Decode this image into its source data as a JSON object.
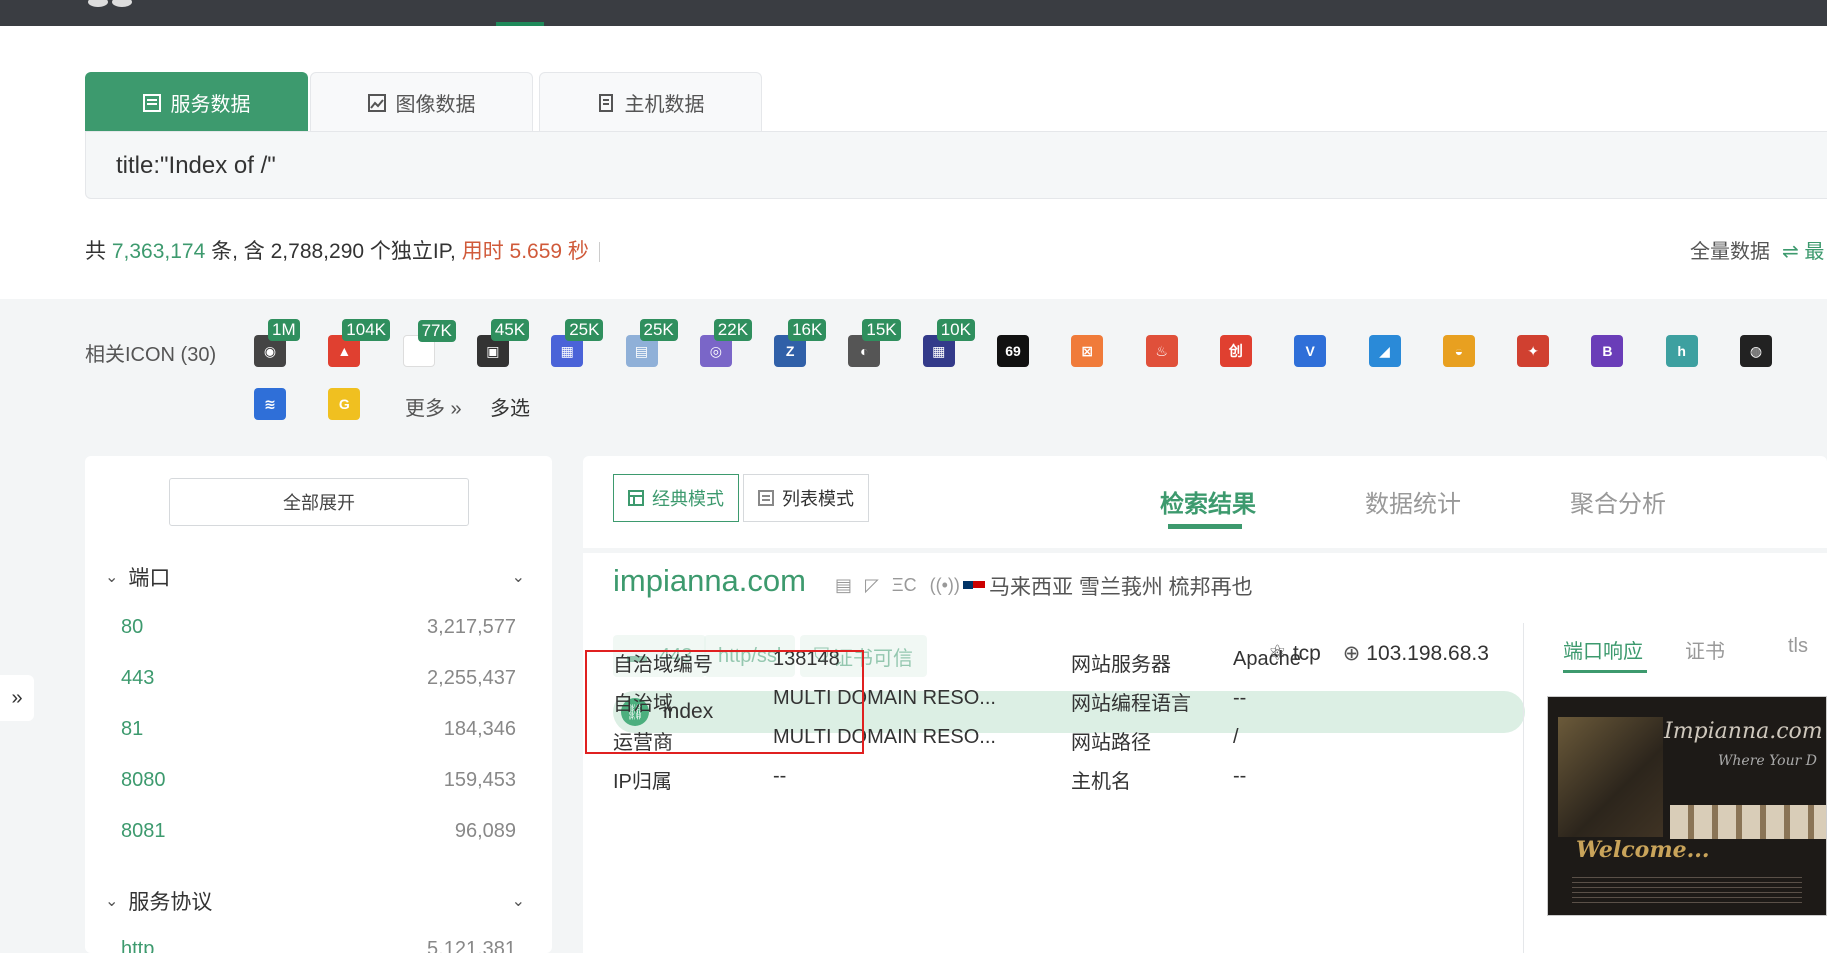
{
  "search_tabs": [
    {
      "label": "服务数据",
      "active": true
    },
    {
      "label": "图像数据",
      "active": false
    },
    {
      "label": "主机数据",
      "active": false
    }
  ],
  "query": "title:\"Index of /\"",
  "stats": {
    "prefix": "共 ",
    "total": "7,363,174",
    "mid1": " 条, 含 ",
    "unique_ip": "2,788,290",
    "mid2": " 个独立IP, ",
    "time": "用时 5.659 秒"
  },
  "full_data_label": "全量数据",
  "full_data_switch": "⇌ 最",
  "related_icon_label": "相关ICON (30)",
  "icons": [
    {
      "name": "camera-favicon",
      "badge": "1M",
      "color": "#444",
      "glyph": "◉"
    },
    {
      "name": "triangle-favicon",
      "badge": "104K",
      "color": "#e04030",
      "glyph": "▲"
    },
    {
      "name": "blank-favicon",
      "badge": "77K",
      "color": "#ffffff",
      "glyph": ""
    },
    {
      "name": "squares-favicon",
      "badge": "45K",
      "color": "#333",
      "glyph": "▣"
    },
    {
      "name": "grid-favicon",
      "badge": "25K",
      "color": "#4a63d8",
      "glyph": "▦"
    },
    {
      "name": "doc-favicon",
      "badge": "25K",
      "color": "#8fb0d8",
      "glyph": "▤"
    },
    {
      "name": "ring-favicon",
      "badge": "22K",
      "color": "#7a66c8",
      "glyph": "◎"
    },
    {
      "name": "z-favicon",
      "badge": "16K",
      "color": "#3060a8",
      "glyph": "Z"
    },
    {
      "name": "moon-favicon",
      "badge": "15K",
      "color": "#555",
      "glyph": "◐"
    },
    {
      "name": "table-favicon",
      "badge": "10K",
      "color": "#333a8a",
      "glyph": "▦"
    },
    {
      "name": "69-favicon",
      "badge": "",
      "color": "#111",
      "glyph": "69"
    },
    {
      "name": "xampp-favicon",
      "badge": "",
      "color": "#f07b3a",
      "glyph": "⊠"
    },
    {
      "name": "flame-favicon",
      "badge": "",
      "color": "#e0503a",
      "glyph": "♨"
    },
    {
      "name": "chuangwen-favicon",
      "badge": "",
      "color": "#e04030",
      "glyph": "创"
    },
    {
      "name": "v-favicon",
      "badge": "",
      "color": "#2f6fd8",
      "glyph": "V"
    },
    {
      "name": "chart-favicon",
      "badge": "",
      "color": "#2a8ad8",
      "glyph": "◢"
    },
    {
      "name": "compass-favicon",
      "badge": "",
      "color": "#e8a020",
      "glyph": "◒"
    },
    {
      "name": "star-favicon",
      "badge": "",
      "color": "#d04030",
      "glyph": "✦"
    },
    {
      "name": "bootstrap-favicon",
      "badge": "",
      "color": "#6a3db8",
      "glyph": "B"
    },
    {
      "name": "hm-favicon",
      "badge": "",
      "color": "#3da0a0",
      "glyph": "h"
    },
    {
      "name": "badge-favicon",
      "badge": "",
      "color": "#222",
      "glyph": "◍"
    },
    {
      "name": "wave-favicon",
      "badge": "",
      "color": "#2f6fd8",
      "glyph": "≋"
    },
    {
      "name": "g-favicon",
      "badge": "",
      "color": "#f0c020",
      "glyph": "G"
    }
  ],
  "more_label": "更多 »",
  "multi_select_label": "多选",
  "expand_all": "全部展开",
  "facets": {
    "port_title": "端口",
    "ports": [
      {
        "k": "80",
        "v": "3,217,577"
      },
      {
        "k": "443",
        "v": "2,255,437"
      },
      {
        "k": "81",
        "v": "184,346"
      },
      {
        "k": "8080",
        "v": "159,453"
      },
      {
        "k": "8081",
        "v": "96,089"
      }
    ],
    "protocol_title": "服务协议",
    "protocols": [
      {
        "k": "http",
        "v": "5,121,381"
      }
    ]
  },
  "modes": {
    "classic": "经典模式",
    "list": "列表模式"
  },
  "view_tabs": {
    "results": "检索结果",
    "stats": "数据统计",
    "aggregate": "聚合分析"
  },
  "result": {
    "domain": "impianna.com",
    "location": "马来西亚 雪兰莪州 梳邦再也",
    "port": "443",
    "protocol": "http/ssl",
    "cert": "证书可信",
    "transport": "tcp",
    "ip": "103.198.68.3",
    "title": "index",
    "info": {
      "asn_label": "自治域编号",
      "asn": "138148",
      "as_label": "自治域",
      "as": "MULTI DOMAIN RESO...",
      "isp_label": "运营商",
      "isp": "MULTI DOMAIN RESO...",
      "ip_loc_label": "IP归属",
      "ip_loc": "--",
      "server_label": "网站服务器",
      "server": "Apache",
      "lang_label": "网站编程语言",
      "lang": "--",
      "path_label": "网站路径",
      "path": "/",
      "host_label": "主机名",
      "host": "--"
    },
    "resp_tabs": {
      "response": "端口响应",
      "cert": "证书",
      "tls": "tls"
    },
    "screenshot": {
      "title": "Impianna.com",
      "subtitle": "Where Your D",
      "welcome": "Welcome..."
    }
  }
}
